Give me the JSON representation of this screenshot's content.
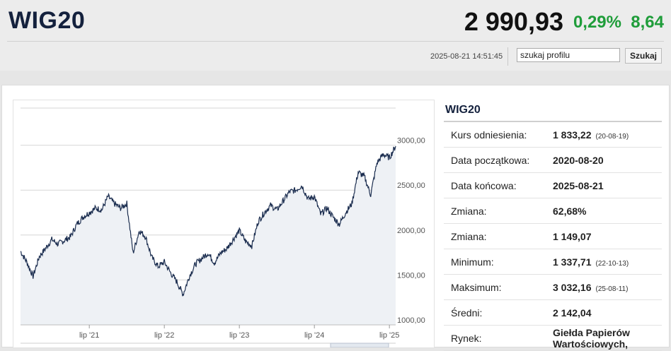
{
  "header": {
    "ticker": "WIG20",
    "price": "2 990,93",
    "change_pct": "0,29%",
    "change_abs": "8,64",
    "timestamp": "2025-08-21 14:51:45",
    "search_value": "szukaj profilu",
    "search_button": "Szukaj"
  },
  "colors": {
    "up": "#1f9d3a",
    "title": "#14213d",
    "line": "#1b2d4f",
    "area": "#eef1f5"
  },
  "info": {
    "title": "WIG20",
    "rows": [
      {
        "label": "Kurs odniesienia:",
        "value": "1 833,22",
        "date": "(20-08-19)"
      },
      {
        "label": "Data początkowa:",
        "value": "2020-08-20",
        "date": ""
      },
      {
        "label": "Data końcowa:",
        "value": "2025-08-21",
        "date": ""
      },
      {
        "label": "Zmiana:",
        "value": "62,68%",
        "date": ""
      },
      {
        "label": "Zmiana:",
        "value": "1 149,07",
        "date": ""
      },
      {
        "label": "Minimum:",
        "value": "1 337,71",
        "date": "(22-10-13)"
      },
      {
        "label": "Maksimum:",
        "value": "3 032,16",
        "date": "(25-08-11)"
      },
      {
        "label": "Średni:",
        "value": "2 142,04",
        "date": ""
      }
    ],
    "market_label": "Rynek:",
    "market_value": "Giełda Papierów Wartościowych,"
  },
  "chart_data": {
    "type": "area",
    "x_ticks": [
      "lip '21",
      "lip '22",
      "lip '23",
      "lip '24",
      "lip '25"
    ],
    "y_ticks": [
      "1000,00",
      "1500,00",
      "2000,00",
      "2500,00",
      "3000,00"
    ],
    "ylim": [
      1000,
      3500
    ],
    "x": [
      "2020-08",
      "2020-09",
      "2020-10",
      "2020-11",
      "2020-12",
      "2021-01",
      "2021-02",
      "2021-03",
      "2021-04",
      "2021-05",
      "2021-06",
      "2021-07",
      "2021-08",
      "2021-09",
      "2021-10",
      "2021-11",
      "2021-12",
      "2022-01",
      "2022-02",
      "2022-03",
      "2022-04",
      "2022-05",
      "2022-06",
      "2022-07",
      "2022-08",
      "2022-09",
      "2022-10",
      "2022-11",
      "2022-12",
      "2023-01",
      "2023-02",
      "2023-03",
      "2023-04",
      "2023-05",
      "2023-06",
      "2023-07",
      "2023-08",
      "2023-09",
      "2023-10",
      "2023-11",
      "2023-12",
      "2024-01",
      "2024-02",
      "2024-03",
      "2024-04",
      "2024-05",
      "2024-06",
      "2024-07",
      "2024-08",
      "2024-09",
      "2024-10",
      "2024-11",
      "2024-12",
      "2025-01",
      "2025-02",
      "2025-03",
      "2025-04",
      "2025-05",
      "2025-06",
      "2025-07",
      "2025-08"
    ],
    "values": [
      1820,
      1700,
      1540,
      1760,
      1850,
      1950,
      1900,
      1940,
      1980,
      2120,
      2200,
      2250,
      2300,
      2280,
      2430,
      2350,
      2300,
      2350,
      1800,
      2050,
      1980,
      1750,
      1650,
      1700,
      1580,
      1480,
      1340,
      1540,
      1680,
      1740,
      1800,
      1690,
      1800,
      1850,
      1950,
      2050,
      1930,
      1880,
      2150,
      2250,
      2330,
      2280,
      2380,
      2480,
      2500,
      2550,
      2400,
      2430,
      2230,
      2300,
      2200,
      2120,
      2250,
      2350,
      2700,
      2650,
      2450,
      2800,
      2900,
      2860,
      2990
    ]
  }
}
